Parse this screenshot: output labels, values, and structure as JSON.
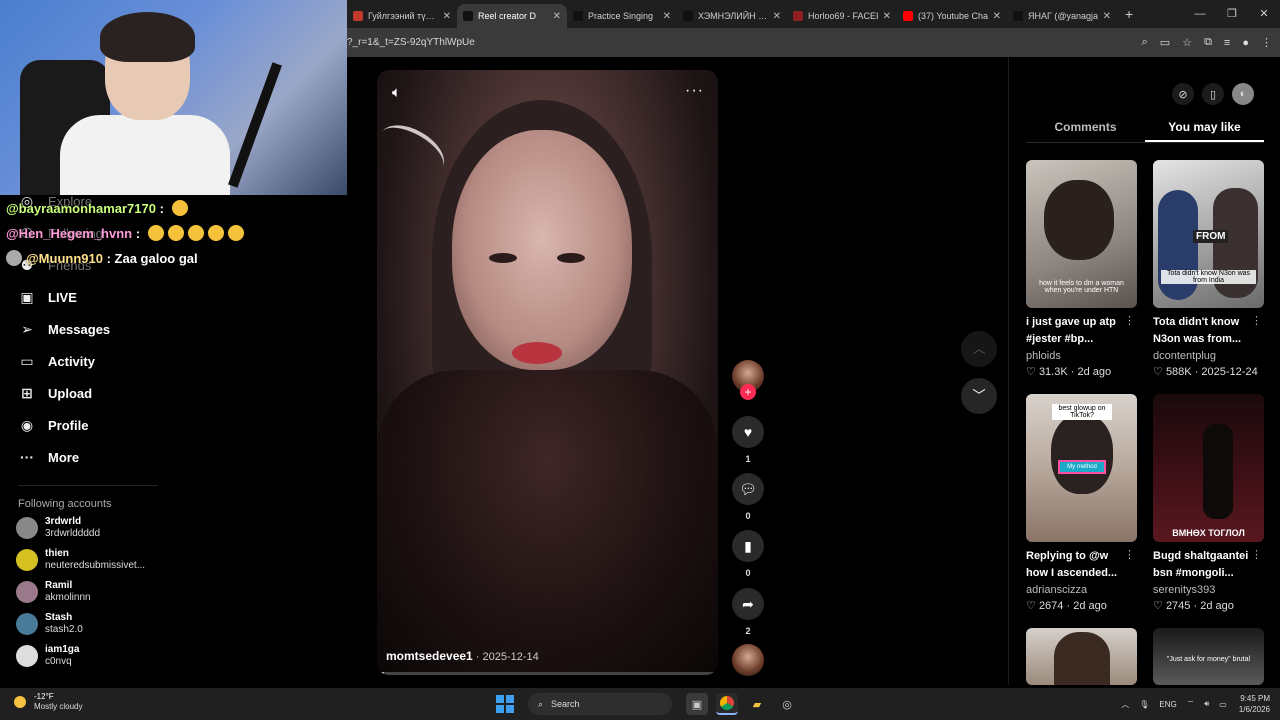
{
  "browser": {
    "tabs": [
      {
        "title": "Гуйлгээний түүх |",
        "active": false,
        "fav": "#c0392b"
      },
      {
        "title": "Reel creator D",
        "active": true,
        "fav": "#111111"
      },
      {
        "title": "Practice Singing",
        "active": false,
        "fav": "#111111"
      },
      {
        "title": "ХЭМНЭЛИЙН ДА",
        "active": false,
        "fav": "#111111"
      },
      {
        "title": "Horloo69 - FACEI",
        "active": false,
        "fav": "#8e2020"
      },
      {
        "title": "(37) Youtube Cha",
        "active": false,
        "fav": "#ff0000"
      },
      {
        "title": "ЯНАГ (@yanagja",
        "active": false,
        "fav": "#111111"
      }
    ],
    "url": "?_r=1&_t=ZS-92qYThlWpUe"
  },
  "chat": [
    {
      "user": "@bayraamonhamar7170",
      "sep": " : ",
      "text": ""
    },
    {
      "user": "@Hen_Hegem_hvnn",
      "sep": " : ",
      "text": ""
    },
    {
      "user": "@Muunn910",
      "sep": " : ",
      "text": "Zaa galoo gal"
    }
  ],
  "sidebar": {
    "faded": [
      "Explore",
      "Following",
      "Friends"
    ],
    "items": [
      {
        "label": "LIVE",
        "icon": "live-tv-icon"
      },
      {
        "label": "Messages",
        "icon": "paper-plane-icon"
      },
      {
        "label": "Activity",
        "icon": "message-icon"
      },
      {
        "label": "Upload",
        "icon": "plus-square-icon"
      },
      {
        "label": "Profile",
        "icon": "avatar-icon"
      },
      {
        "label": "More",
        "icon": "more-dots-icon"
      }
    ],
    "following_title": "Following accounts",
    "accounts": [
      {
        "name": "3rdwrld",
        "handle": "3rdwrlddddd",
        "color": "#888888"
      },
      {
        "name": "thien",
        "handle": "neuteredsubmissivet...",
        "color": "#d4c020"
      },
      {
        "name": "Ramil",
        "handle": "akmolinnn",
        "color": "#9a7a8a"
      },
      {
        "name": "Stash",
        "handle": "stash2.0",
        "color": "#4a7a9a"
      },
      {
        "name": "iam1ga",
        "handle": "c0nvq",
        "color": "#dddddd"
      }
    ]
  },
  "video": {
    "author": "momtsedevee1",
    "date": "2025-12-14",
    "separator": " · ",
    "progress": 0.02
  },
  "actions": {
    "likes": "1",
    "comments": "0",
    "saves": "0",
    "shares": "2"
  },
  "right_panel": {
    "tabs": [
      "Comments",
      "You may like"
    ],
    "active_tab": 1,
    "cards": [
      {
        "title": "i just gave up atp #jester #bp...",
        "author": "phloids",
        "likes": "31.3K",
        "age": "2d ago",
        "thumb_text": "how it feels to dm a woman when you're under HTN"
      },
      {
        "title": "Tota didn't know N3on was from...",
        "author": "dcontentplug",
        "likes": "588K",
        "age": "2025-12-24",
        "thumb_text": "Tota didn't know N3on was from India"
      },
      {
        "title": "Replying to @w how I ascended...",
        "author": "adrianscizza",
        "likes": "2674",
        "age": "2d ago",
        "thumb_text": "best glowup on TikTok?"
      },
      {
        "title": "Bugd shaltgaantei bsn #mongoli...",
        "author": "serenitys393",
        "likes": "2745",
        "age": "2d ago",
        "thumb_text": "ВМНӨХ ТОГЛОЛ"
      },
      {
        "title": "",
        "author": "",
        "likes": "",
        "age": "",
        "thumb_text": ""
      },
      {
        "title": "",
        "author": "",
        "likes": "",
        "age": "",
        "thumb_text": "\"Just ask for money\" brutal"
      }
    ],
    "thumb_extra": {
      "from": "FROM",
      "my_method": "My method"
    }
  },
  "taskbar": {
    "temp": "-12°F",
    "weather": "Mostly cloudy",
    "search": "Search",
    "lang": "ENG",
    "time": "9:45 PM",
    "date": "1/6/2026"
  }
}
